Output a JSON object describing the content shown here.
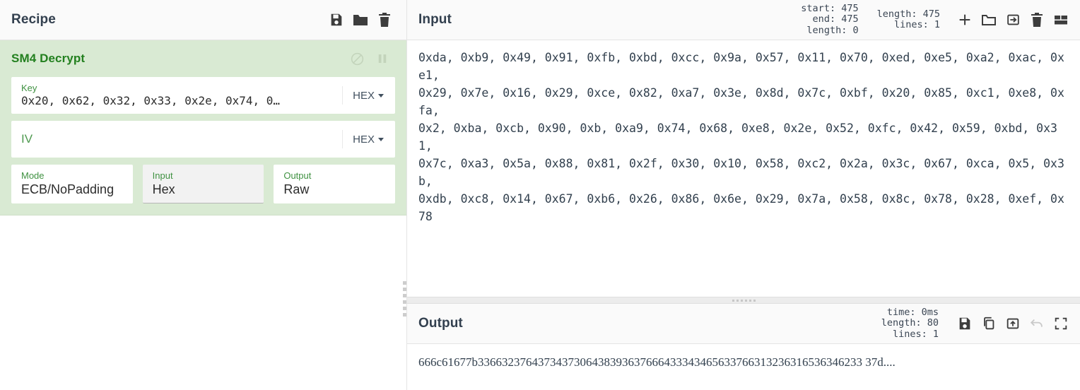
{
  "recipe": {
    "title": "Recipe",
    "controls": [
      {
        "name": "save-recipe-button",
        "icon": "floppy-disk-icon"
      },
      {
        "name": "load-recipe-button",
        "icon": "folder-icon"
      },
      {
        "name": "clear-recipe-button",
        "icon": "trash-icon"
      }
    ],
    "operation": {
      "title": "SM4 Decrypt",
      "disable_icon": "circle-slash-icon",
      "breakpoint_icon": "pause-icon",
      "args": {
        "key": {
          "label": "Key",
          "value": "0x20, 0x62, 0x32, 0x33, 0x2e, 0x74, 0…",
          "format": "HEX"
        },
        "iv": {
          "label": "IV",
          "value": "",
          "placeholder": "IV",
          "format": "HEX"
        },
        "mode": {
          "label": "Mode",
          "value": "ECB/NoPadding"
        },
        "input": {
          "label": "Input",
          "value": "Hex"
        },
        "output": {
          "label": "Output",
          "value": "Raw"
        }
      }
    }
  },
  "input": {
    "title": "Input",
    "selection": {
      "start_label": "start:",
      "start": "475",
      "end_label": "end:",
      "end": "475",
      "length_label": "length:",
      "length": "0"
    },
    "stats": {
      "length_label": "length:",
      "length": "475",
      "lines_label": "lines:",
      "lines": "1"
    },
    "controls": [
      {
        "name": "add-input-tab-button",
        "icon": "plus-icon"
      },
      {
        "name": "open-file-button",
        "icon": "folder-icon"
      },
      {
        "name": "open-folder-as-input-button",
        "icon": "box-arrow-in-icon"
      },
      {
        "name": "clear-io-button",
        "icon": "trash-icon"
      },
      {
        "name": "input-layout-button",
        "icon": "panel-layout-icon"
      }
    ],
    "text": "0xda, 0xb9, 0x49, 0x91, 0xfb, 0xbd, 0xcc, 0x9a, 0x57, 0x11, 0x70, 0xed, 0xe5, 0xa2, 0xac, 0xe1,\n0x29, 0x7e, 0x16, 0x29, 0xce, 0x82, 0xa7, 0x3e, 0x8d, 0x7c, 0xbf, 0x20, 0x85, 0xc1, 0xe8, 0xfa,\n0x2, 0xba, 0xcb, 0x90, 0xb, 0xa9, 0x74, 0x68, 0xe8, 0x2e, 0x52, 0xfc, 0x42, 0x59, 0xbd, 0x31,\n0x7c, 0xa3, 0x5a, 0x88, 0x81, 0x2f, 0x30, 0x10, 0x58, 0xc2, 0x2a, 0x3c, 0x67, 0xca, 0x5, 0x3b,\n0xdb, 0xc8, 0x14, 0x67, 0xb6, 0x26, 0x86, 0x6e, 0x29, 0x7a, 0x58, 0x8c, 0x78, 0x28, 0xef, 0x78"
  },
  "output": {
    "title": "Output",
    "stats": {
      "time_label": "time:",
      "time": "0ms",
      "length_label": "length:",
      "length": "80",
      "lines_label": "lines:",
      "lines": "1"
    },
    "controls": [
      {
        "name": "save-output-button",
        "icon": "floppy-disk-icon"
      },
      {
        "name": "copy-output-button",
        "icon": "copy-icon"
      },
      {
        "name": "replace-input-button",
        "icon": "box-arrow-up-icon"
      },
      {
        "name": "undo-bake-button",
        "icon": "undo-icon"
      },
      {
        "name": "maximise-output-button",
        "icon": "maximise-icon"
      }
    ],
    "text": "666c61677b3366323764373437306438393637666433343465633766313236316536346233 37d...."
  },
  "theme": {
    "operation_bg": "#d9ead3",
    "operation_title": "#23801f",
    "panel_header_bg": "#fafafa",
    "text": "#32404e"
  }
}
